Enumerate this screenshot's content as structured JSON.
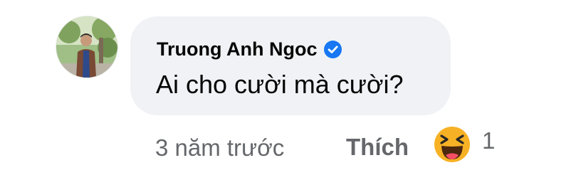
{
  "comment": {
    "author": "Truong Anh Ngoc",
    "verified": true,
    "text": "Ai cho cười mà cười?",
    "timestamp": "3 năm trước",
    "like_label": "Thích",
    "reaction": {
      "type": "haha",
      "icon": "laughing-emoji-icon",
      "count": "1"
    }
  },
  "colors": {
    "bubble_bg": "#f0f2f5",
    "text_primary": "#050505",
    "text_secondary": "#65676b",
    "verified_badge": "#1877f2",
    "emoji_yellow": "#f7b125"
  }
}
